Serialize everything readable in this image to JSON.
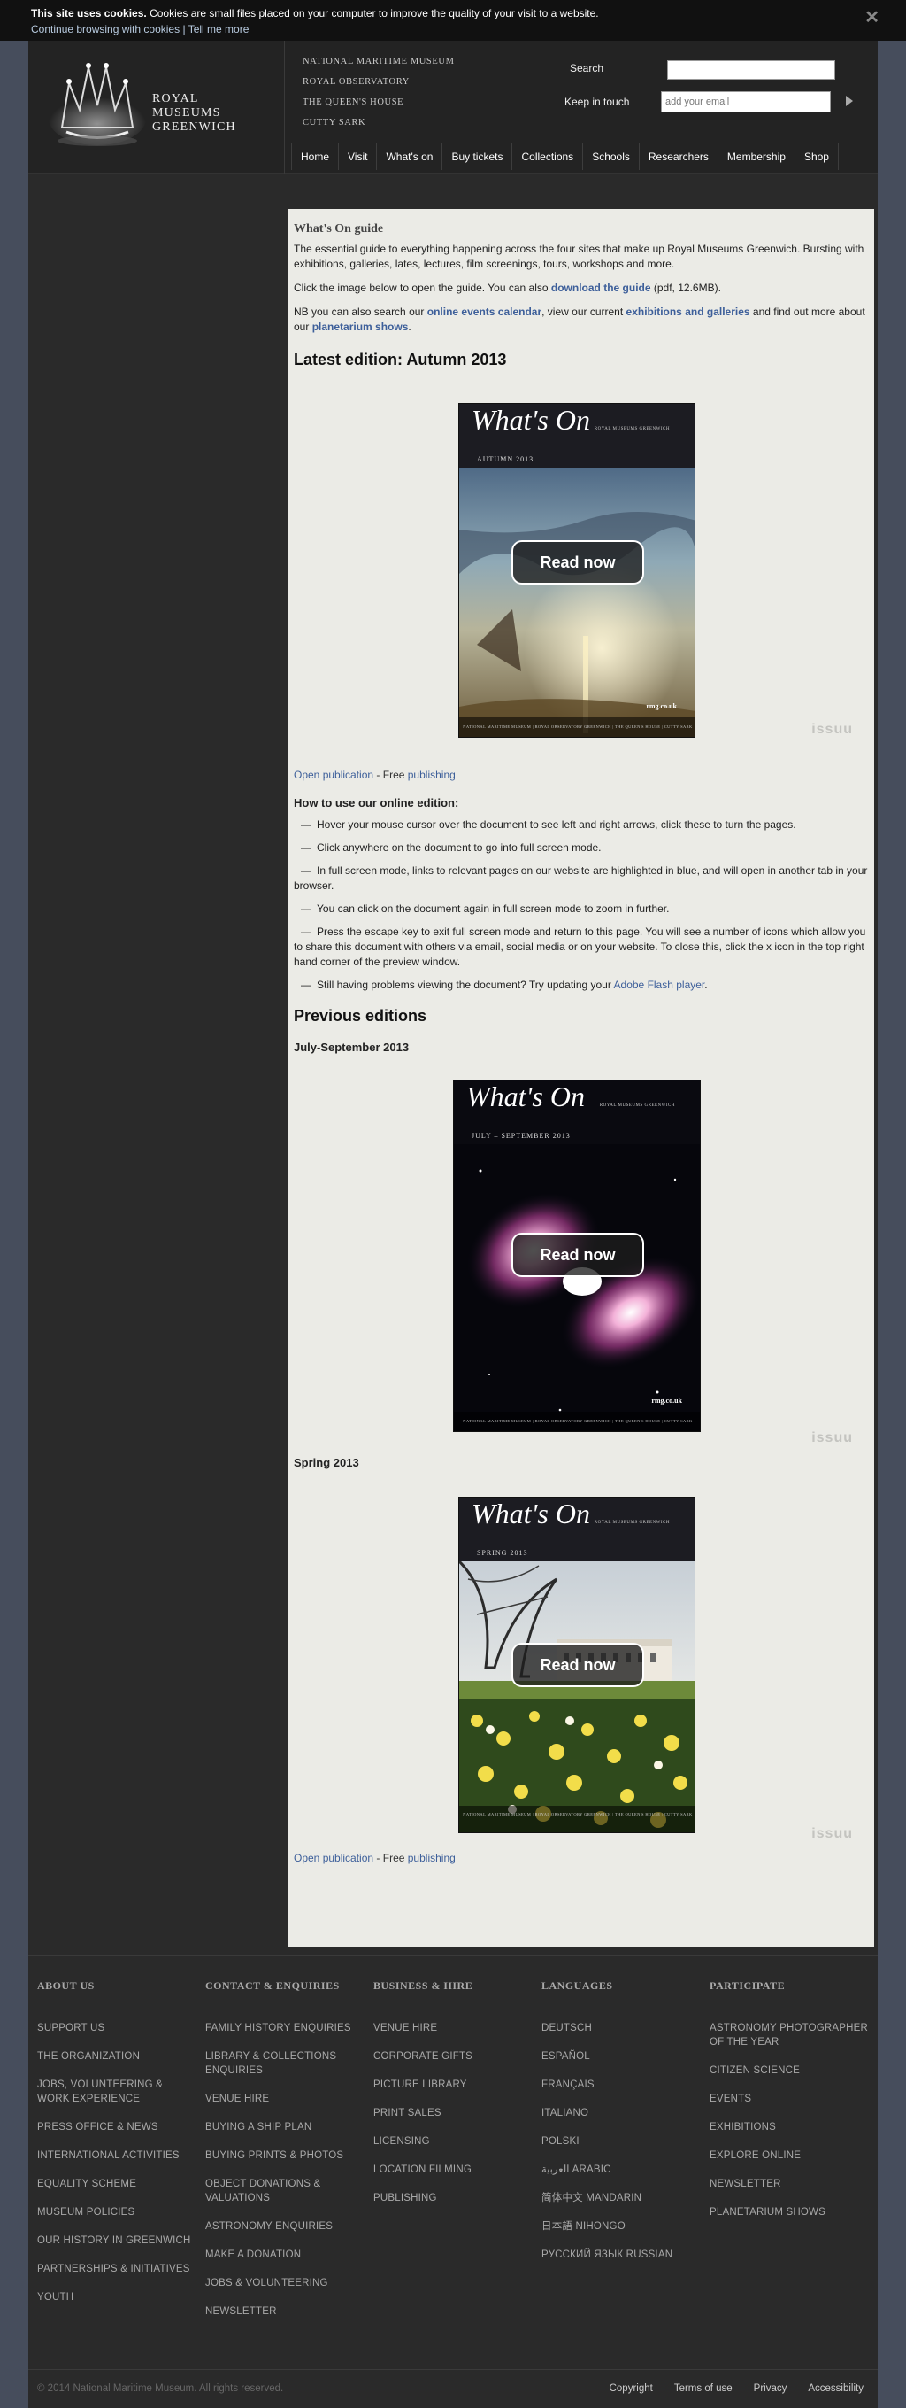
{
  "cookie": {
    "bold": "This site uses cookies.",
    "text": " Cookies are small files placed on your computer to improve the quality of your visit to a website.",
    "continue": "Continue browsing with cookies",
    "separator": "|",
    "tell_more": "Tell me more",
    "close": "✕"
  },
  "logo": {
    "line1": "ROYAL",
    "line2": "MUSEUMS",
    "line3": "GREENWICH"
  },
  "sites": [
    "NATIONAL MARITIME MUSEUM",
    "ROYAL OBSERVATORY",
    "THE QUEEN'S HOUSE",
    "CUTTY SARK"
  ],
  "search": {
    "label": "Search",
    "value": ""
  },
  "newsletter": {
    "label": "Keep in touch",
    "placeholder": "add your email"
  },
  "nav": [
    "Home",
    "Visit",
    "What's on",
    "Buy tickets",
    "Collections",
    "Schools",
    "Researchers",
    "Membership",
    "Shop"
  ],
  "content": {
    "title": "What's On guide",
    "intro": "The essential guide to everything happening across the four sites that make up Royal Museums Greenwich. Bursting with exhibitions, galleries, lates, lectures, film screenings, tours, workshops and more.",
    "click_pre": "Click the image below to open the guide. You can also ",
    "click_link": "download the guide",
    "click_post": " (pdf, 12.6MB).",
    "nb_1": "NB you can also search our ",
    "nb_link1": "online events calendar",
    "nb_2": ", view our current ",
    "nb_link2": "exhibitions and galleries",
    "nb_3": " and find out more about our ",
    "nb_link3": "planetarium shows",
    "nb_4": ".",
    "latest_heading": "Latest edition: Autumn 2013",
    "open_publication": "Open publication",
    "free": " - Free ",
    "publishing": "publishing",
    "how_heading": "How to use our online edition:",
    "how_items": [
      "Hover your mouse cursor over the document to see left and right arrows, click these to turn the pages.",
      "Click anywhere on the document to go into full screen mode.",
      "In full screen mode, links to relevant pages on our website are highlighted in blue, and will open in another tab in your browser.",
      "You can click on the document again in full screen mode to zoom in further.",
      "Press the escape key to exit full screen mode and return to this page. You will see a number of icons which allow you to share this document with others via email, social media or on your website. To close this, click the x icon in the top right hand corner of the preview window."
    ],
    "flash_pre": "Still having problems viewing the document? Try updating your ",
    "flash_link": "Adobe Flash player",
    "flash_post": ".",
    "previous_heading": "Previous editions",
    "edition_july": "July-September 2013",
    "edition_spring": "Spring 2013"
  },
  "covers": {
    "title": "What's On",
    "autumn_season": "AUTUMN 2013",
    "july_season": "JULY – SEPTEMBER 2013",
    "spring_season": "SPRING 2013",
    "brand": "ROYAL MUSEUMS GREENWICH",
    "rmg": "rmg.co.uk",
    "foot": "NATIONAL MARITIME MUSEUM | ROYAL OBSERVATORY GREENWICH | THE QUEEN'S HOUSE | CUTTY SARK",
    "read_now": "Read now",
    "issuu": "issuu"
  },
  "footer": {
    "cols": [
      {
        "heading": "ABOUT US",
        "items": [
          "SUPPORT US",
          "THE ORGANIZATION",
          "JOBS, VOLUNTEERING & WORK EXPERIENCE",
          "PRESS OFFICE & NEWS",
          "INTERNATIONAL ACTIVITIES",
          "EQUALITY SCHEME",
          "MUSEUM POLICIES",
          "OUR HISTORY IN GREENWICH",
          "PARTNERSHIPS & INITIATIVES",
          "YOUTH"
        ]
      },
      {
        "heading": "CONTACT & ENQUIRIES",
        "items": [
          "FAMILY HISTORY ENQUIRIES",
          "LIBRARY & COLLECTIONS ENQUIRIES",
          "VENUE HIRE",
          "BUYING A SHIP PLAN",
          "BUYING PRINTS & PHOTOS",
          "OBJECT DONATIONS & VALUATIONS",
          "ASTRONOMY ENQUIRIES",
          "MAKE A DONATION",
          "JOBS & VOLUNTEERING",
          "NEWSLETTER"
        ]
      },
      {
        "heading": "BUSINESS & HIRE",
        "items": [
          "VENUE HIRE",
          "CORPORATE GIFTS",
          "PICTURE LIBRARY",
          "PRINT SALES",
          "LICENSING",
          "LOCATION FILMING",
          "PUBLISHING"
        ]
      },
      {
        "heading": "LANGUAGES",
        "items": [
          "DEUTSCH",
          "ESPAÑOL",
          "FRANÇAIS",
          "ITALIANO",
          "POLSKI",
          "العربية ARABIC",
          "简体中文 MANDARIN",
          "日本語 NIHONGO",
          "РУССКИЙ ЯЗЫК RUSSIAN"
        ]
      },
      {
        "heading": "PARTICIPATE",
        "items": [
          "ASTRONOMY PHOTOGRAPHER OF THE YEAR",
          "CITIZEN SCIENCE",
          "EVENTS",
          "EXHIBITIONS",
          "EXPLORE ONLINE",
          "NEWSLETTER",
          "PLANETARIUM SHOWS"
        ]
      }
    ],
    "copyright": "© 2014 National Maritime Museum. All rights reserved.",
    "links": [
      "Copyright",
      "Terms of use",
      "Privacy",
      "Accessibility"
    ]
  }
}
